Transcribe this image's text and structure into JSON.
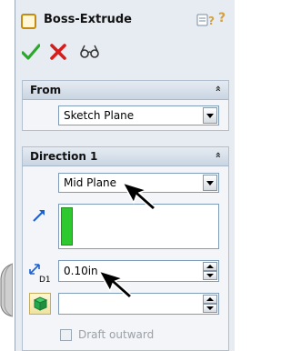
{
  "feature": {
    "title": "Boss-Extrude",
    "help_glyph": "?"
  },
  "actions": {
    "ok_icon": "check-icon",
    "cancel_icon": "x-icon",
    "preview_icon": "glasses-icon"
  },
  "from_group": {
    "header": "From",
    "collapse_glyph": "»",
    "start_condition": "Sketch Plane"
  },
  "direction1_group": {
    "header": "Direction 1",
    "collapse_glyph": "»",
    "end_condition": "Mid Plane",
    "depth_label": "D1",
    "depth_value": "0.10in",
    "draft_outward_label": "Draft outward",
    "draft_outward_checked": false
  },
  "colors": {
    "accent_green": "#2ec92e",
    "panel_bg": "#e7ecf2",
    "header_grad_bottom": "#c9d5e2"
  }
}
